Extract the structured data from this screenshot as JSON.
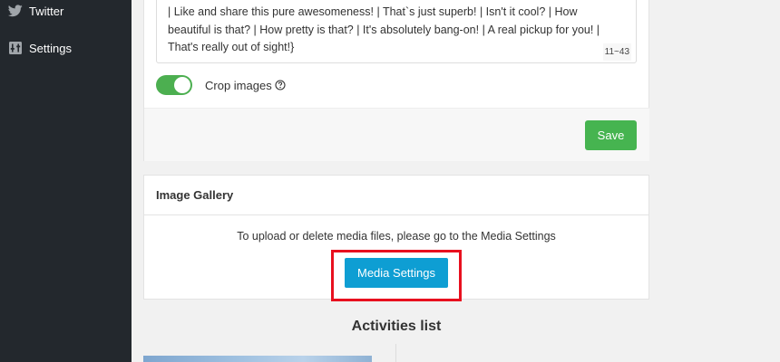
{
  "sidebar": {
    "items": [
      {
        "label": "Twitter",
        "icon": "twitter-icon"
      },
      {
        "label": "Settings",
        "icon": "settings-icon"
      }
    ]
  },
  "settings_card": {
    "textarea_lines": [
      "| Like and share this pure awesomeness! | That`s just superb! | Isn't it cool? | How",
      "beautiful is that? | How pretty is that? | It's absolutely bang-on! | A real pickup for you! |",
      "That's really out of sight!}"
    ],
    "char_counter": "11~43",
    "crop_images_label": "Crop images",
    "crop_images_enabled": true,
    "save_label": "Save"
  },
  "gallery": {
    "title": "Image Gallery",
    "description": "To upload or delete media files, please go to the Media Settings",
    "media_button_label": "Media Settings"
  },
  "activities": {
    "title": "Activities list"
  },
  "colors": {
    "sidebar_bg": "#23282d",
    "save_green": "#46b450",
    "toggle_green": "#4caf50",
    "media_blue": "#0e9ed3",
    "highlight_red": "#e8101f"
  }
}
